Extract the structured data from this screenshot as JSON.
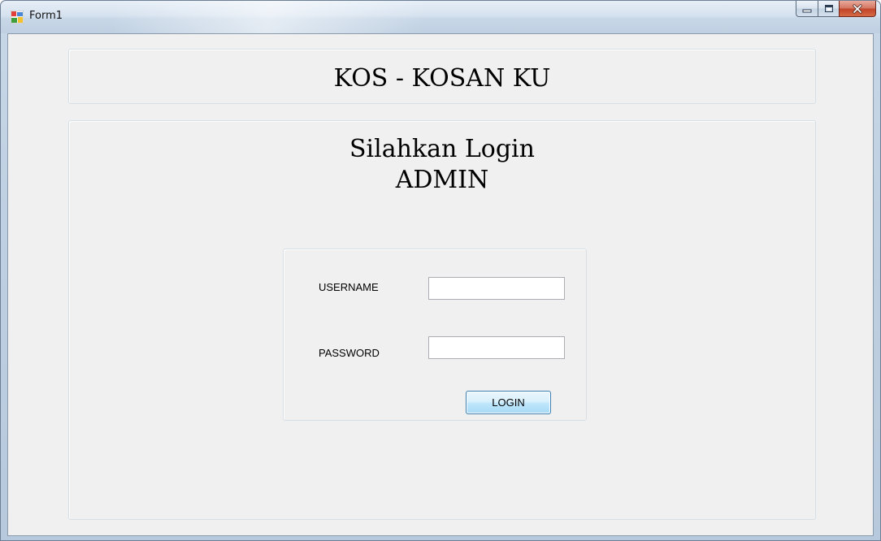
{
  "window": {
    "title": "Form1",
    "icon": "winforms-app-icon",
    "controls": [
      "minimize-icon",
      "maximize-icon",
      "close-icon"
    ]
  },
  "header": {
    "title": "KOS - KOSAN KU"
  },
  "main": {
    "heading_line1": "Silahkan Login",
    "heading_line2": "ADMIN"
  },
  "login": {
    "username_label": "USERNAME",
    "username_value": "",
    "password_label": "PASSWORD",
    "password_value": "",
    "login_button": "LOGIN"
  },
  "colors": {
    "form_background": "#f0f0f0",
    "button_border": "#3c7fb1",
    "close_button": "#c2452b"
  }
}
